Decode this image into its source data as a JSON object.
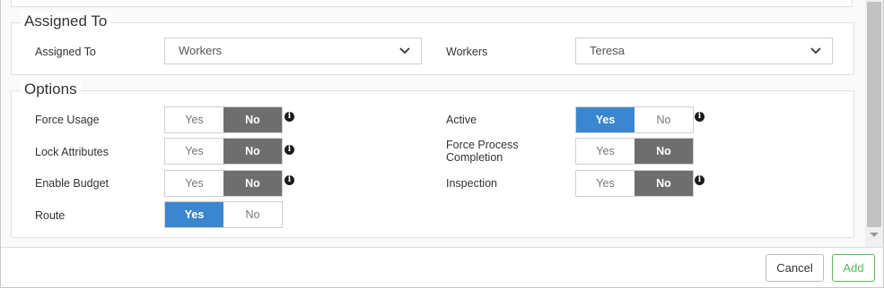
{
  "assigned_section": {
    "title": "Assigned To",
    "assigned_to_label": "Assigned To",
    "assigned_to_value": "Workers",
    "workers_label": "Workers",
    "workers_value": "Teresa"
  },
  "options_section": {
    "title": "Options",
    "toggles": [
      {
        "label": "Force Usage",
        "yes": "Yes",
        "no": "No",
        "selected": "No",
        "info": true
      },
      {
        "label": "Lock Attributes",
        "yes": "Yes",
        "no": "No",
        "selected": "No",
        "info": true
      },
      {
        "label": "Enable Budget",
        "yes": "Yes",
        "no": "No",
        "selected": "No",
        "info": true
      },
      {
        "label": "Route",
        "yes": "Yes",
        "no": "No",
        "selected": "Yes",
        "info": false
      },
      {
        "label": "Active",
        "yes": "Yes",
        "no": "No",
        "selected": "Yes",
        "info": true
      },
      {
        "label_line1": "Force Process",
        "label_line2": "Completion",
        "yes": "Yes",
        "no": "No",
        "selected": "No",
        "info": false
      },
      {
        "label": "Inspection",
        "yes": "Yes",
        "no": "No",
        "selected": "No",
        "info": true
      }
    ]
  },
  "footer": {
    "cancel_label": "Cancel",
    "add_label": "Add"
  },
  "colors": {
    "yes_active": "#3a87cf",
    "no_active": "#6e6e6e",
    "add_green": "#5cb85c"
  },
  "icons": {
    "dropdown": "chevron-down-icon",
    "info": "info-icon"
  }
}
